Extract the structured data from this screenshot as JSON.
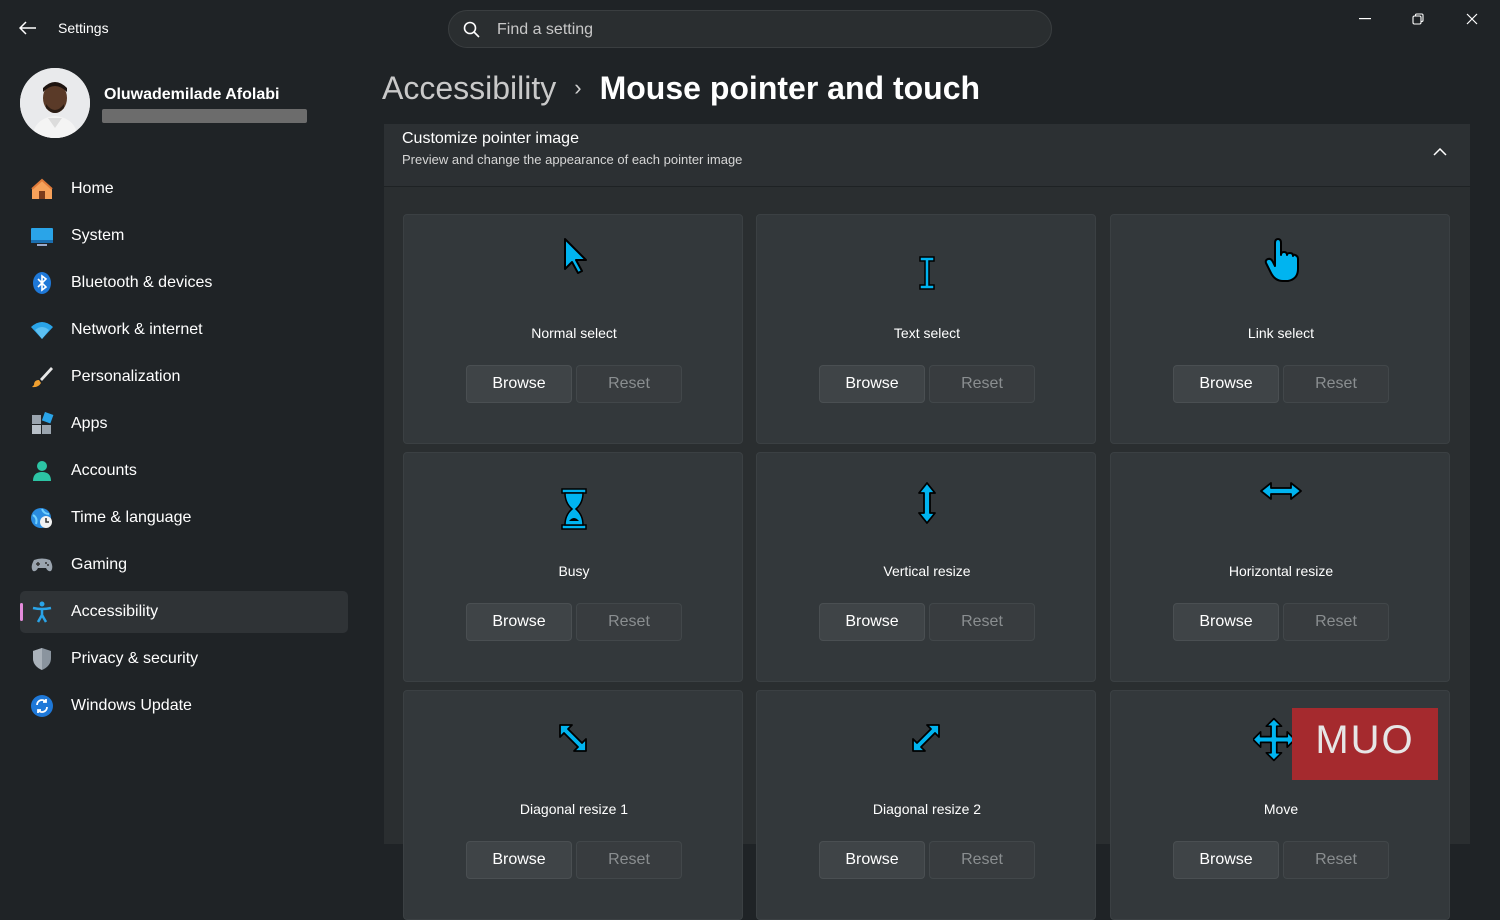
{
  "titlebar": {
    "app_title": "Settings",
    "icons": {
      "back": "back-arrow-icon",
      "minimize": "minimize-icon",
      "restore": "restore-icon",
      "close": "close-icon"
    }
  },
  "search": {
    "placeholder": "Find a setting",
    "icon": "search-icon"
  },
  "profile": {
    "name": "Oluwademilade Afolabi"
  },
  "nav": {
    "items": [
      {
        "label": "Home",
        "icon": "home-icon"
      },
      {
        "label": "System",
        "icon": "system-icon"
      },
      {
        "label": "Bluetooth & devices",
        "icon": "bluetooth-icon"
      },
      {
        "label": "Network & internet",
        "icon": "wifi-icon"
      },
      {
        "label": "Personalization",
        "icon": "brush-icon"
      },
      {
        "label": "Apps",
        "icon": "apps-icon"
      },
      {
        "label": "Accounts",
        "icon": "account-icon"
      },
      {
        "label": "Time & language",
        "icon": "globe-clock-icon"
      },
      {
        "label": "Gaming",
        "icon": "gamepad-icon"
      },
      {
        "label": "Accessibility",
        "icon": "accessibility-icon",
        "active": true
      },
      {
        "label": "Privacy & security",
        "icon": "shield-icon"
      },
      {
        "label": "Windows Update",
        "icon": "update-icon"
      }
    ]
  },
  "breadcrumb": {
    "parent": "Accessibility",
    "separator": "›",
    "current": "Mouse pointer and touch"
  },
  "section": {
    "title": "Customize pointer image",
    "subtitle": "Preview and change the appearance of each pointer image"
  },
  "buttons": {
    "browse": "Browse",
    "reset": "Reset"
  },
  "pointers": [
    {
      "name": "Normal select",
      "icon": "arrow-pointer-icon"
    },
    {
      "name": "Text select",
      "icon": "ibeam-pointer-icon"
    },
    {
      "name": "Link select",
      "icon": "hand-pointer-icon"
    },
    {
      "name": "Busy",
      "icon": "hourglass-pointer-icon"
    },
    {
      "name": "Vertical resize",
      "icon": "vertical-resize-icon"
    },
    {
      "name": "Horizontal resize",
      "icon": "horizontal-resize-icon"
    },
    {
      "name": "Diagonal resize 1",
      "icon": "diagonal-resize-1-icon"
    },
    {
      "name": "Diagonal resize 2",
      "icon": "diagonal-resize-2-icon"
    },
    {
      "name": "Move",
      "icon": "move-pointer-icon"
    }
  ],
  "watermark": {
    "text": "MUO"
  },
  "colors": {
    "accent": "#00b4f0",
    "active_indicator": "#e58cdc",
    "background": "#1f2326",
    "card": "#33383b"
  }
}
